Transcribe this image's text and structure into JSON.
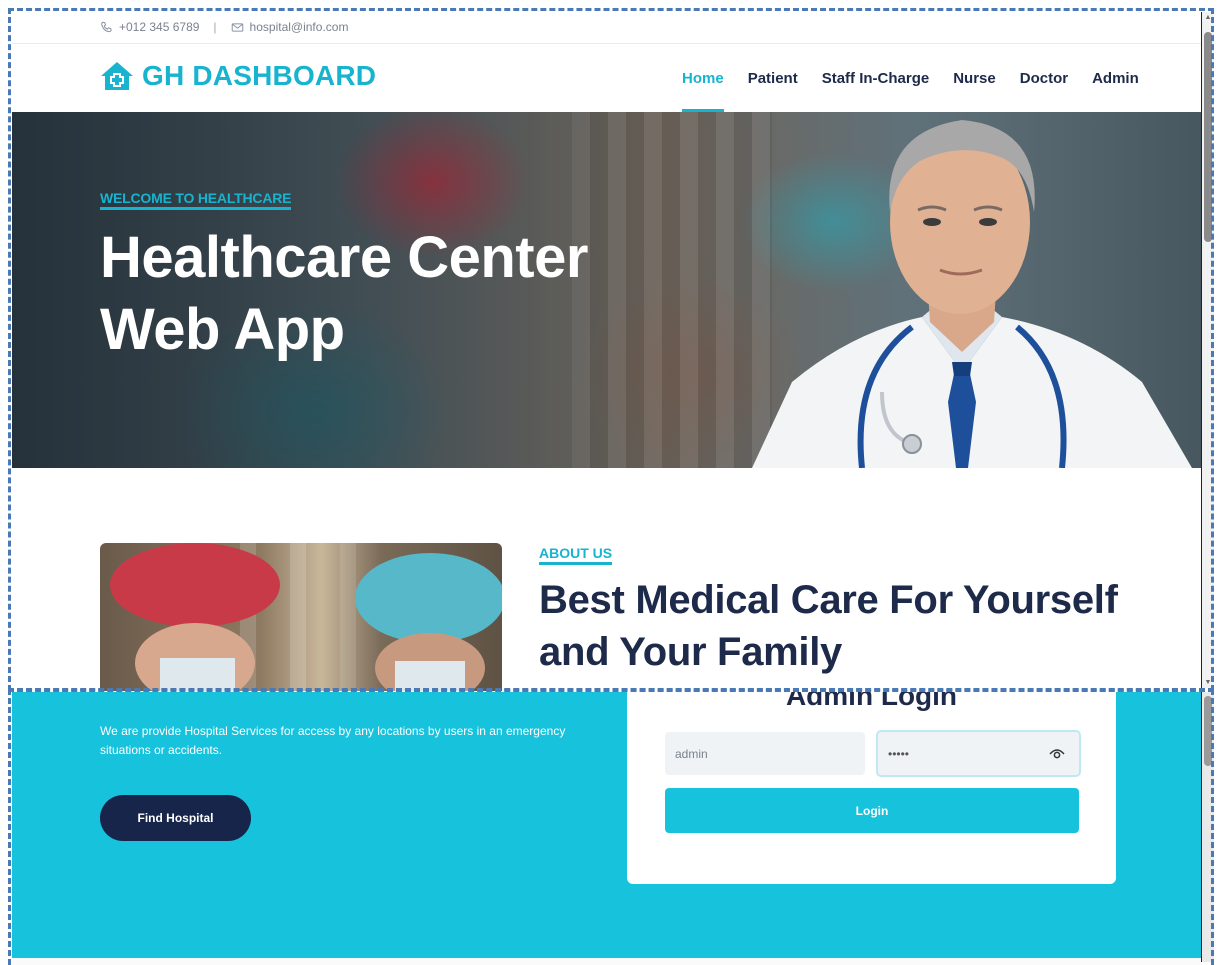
{
  "topbar": {
    "phone": "+012 345 6789",
    "separator": "|",
    "email": "hospital@info.com"
  },
  "navbar": {
    "brand": "GH DASHBOARD",
    "links": [
      {
        "label": "Home",
        "active": true
      },
      {
        "label": "Patient",
        "active": false
      },
      {
        "label": "Staff In-Charge",
        "active": false
      },
      {
        "label": "Nurse",
        "active": false
      },
      {
        "label": "Doctor",
        "active": false
      },
      {
        "label": "Admin",
        "active": false
      }
    ]
  },
  "hero": {
    "eyebrow": "WELCOME TO HEALTHCARE",
    "title": "Healthcare Center Web App"
  },
  "about": {
    "eyebrow": "ABOUT US",
    "title": "Best Medical Care For Yourself and Your Family"
  },
  "services": {
    "description": "We are provide Hospital Services for access by any locations by users in an emergency situations or accidents.",
    "find_button": "Find Hospital"
  },
  "login": {
    "title": "Admin Login",
    "username_value": "admin",
    "password_value": "•••••",
    "button": "Login"
  },
  "colors": {
    "accent": "#17b3cf",
    "navy": "#1e2a4a",
    "cyan_section": "#16c2dc",
    "button_dark": "#17254a"
  },
  "icons": {
    "phone": "phone-icon",
    "email": "envelope-icon",
    "brand": "house-medical-icon",
    "password_toggle": "eye-icon"
  }
}
